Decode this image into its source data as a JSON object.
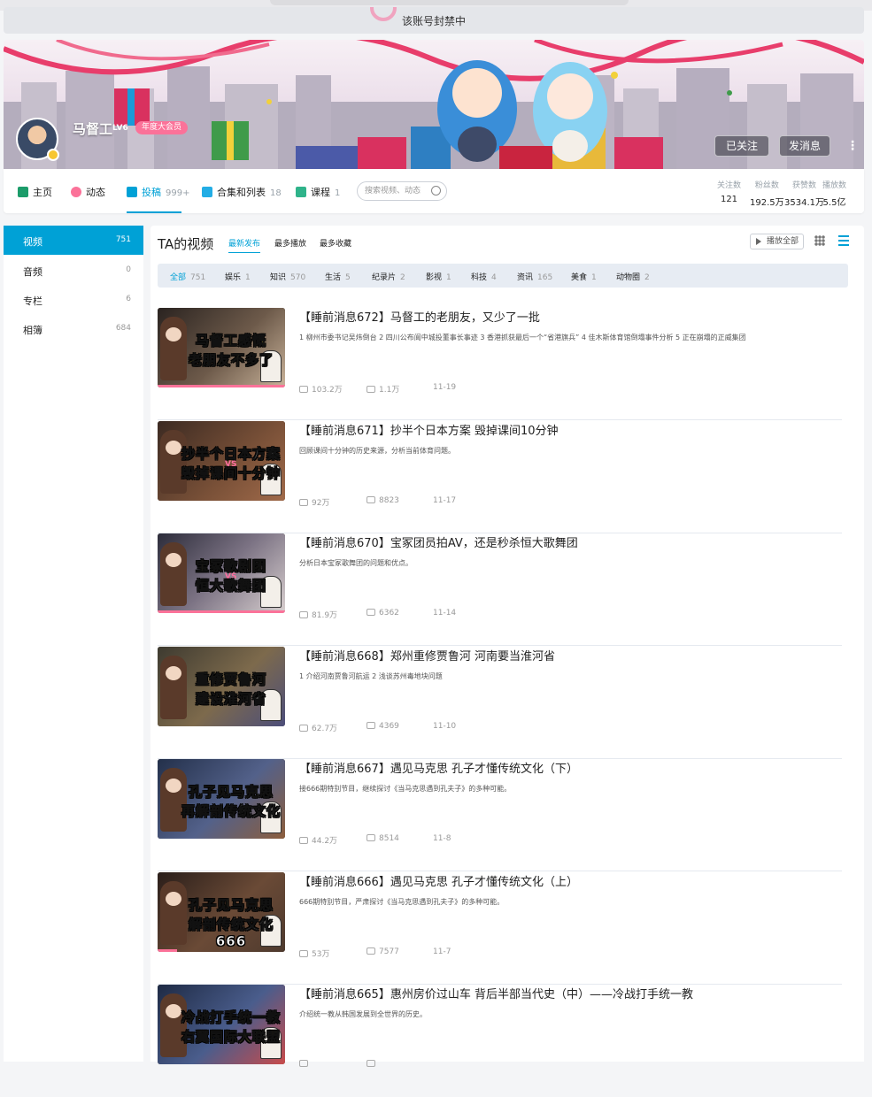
{
  "notice": {
    "text": "该账号封禁中"
  },
  "header": {
    "username": "马督工",
    "level": "LV6",
    "vip_label": "年度大会员",
    "follow_button": "已关注",
    "message_button": "发消息"
  },
  "nav": {
    "tabs": [
      {
        "label": "主页",
        "count": ""
      },
      {
        "label": "动态",
        "count": ""
      },
      {
        "label": "投稿",
        "count": "999+"
      },
      {
        "label": "合集和列表",
        "count": "18"
      },
      {
        "label": "课程",
        "count": "1"
      }
    ],
    "search_placeholder": "搜索视频、动态",
    "stats": [
      {
        "label": "关注数",
        "value": "121"
      },
      {
        "label": "粉丝数",
        "value": "192.5万"
      },
      {
        "label": "获赞数",
        "value": "3534.1万"
      },
      {
        "label": "播放数",
        "value": "5.5亿"
      }
    ]
  },
  "sidebar": {
    "items": [
      {
        "label": "视频",
        "count": "751"
      },
      {
        "label": "音频",
        "count": "0"
      },
      {
        "label": "专栏",
        "count": "6"
      },
      {
        "label": "相簿",
        "count": "684"
      }
    ]
  },
  "main": {
    "title": "TA的视频",
    "sort_tabs": [
      "最新发布",
      "最多播放",
      "最多收藏"
    ],
    "play_all": "播放全部",
    "filters": [
      {
        "label": "全部",
        "count": "751"
      },
      {
        "label": "娱乐",
        "count": "1"
      },
      {
        "label": "知识",
        "count": "570"
      },
      {
        "label": "生活",
        "count": "5"
      },
      {
        "label": "纪录片",
        "count": "2"
      },
      {
        "label": "影视",
        "count": "1"
      },
      {
        "label": "科技",
        "count": "4"
      },
      {
        "label": "资讯",
        "count": "165"
      },
      {
        "label": "美食",
        "count": "1"
      },
      {
        "label": "动物圈",
        "count": "2"
      }
    ],
    "videos": [
      {
        "title": "【睡前消息672】马督工的老朋友，又少了一批",
        "desc": "1 柳州市委书记吴炜倒台 2 四川公布阆中城投董事长事迹 3 香港抓获最后一个“省港旗兵” 4 佳木斯体育馆倒塌事件分析 5 正在崩塌的正威集团",
        "views": "103.2万",
        "comments": "1.1万",
        "date": "11-19",
        "thumb_line1": "马督工感慨",
        "thumb_line2": "老朋友不多了",
        "thumb_vs": ""
      },
      {
        "title": "【睡前消息671】抄半个日本方案 毁掉课间10分钟",
        "desc": "回顾课间十分钟的历史来源，分析当前体育问题。",
        "views": "92万",
        "comments": "8823",
        "date": "11-17",
        "thumb_line1": "抄半个日本方案",
        "thumb_line2": "毁掉课间十分钟",
        "thumb_vs": "VS"
      },
      {
        "title": "【睡前消息670】宝冢团员拍AV，还是秒杀恒大歌舞团",
        "desc": "分析日本宝冢歌舞团的问题和优点。",
        "views": "81.9万",
        "comments": "6362",
        "date": "11-14",
        "thumb_line1": "宝冢歌剧团",
        "thumb_line2": "恒大歌舞团",
        "thumb_vs": "VS"
      },
      {
        "title": "【睡前消息668】郑州重修贾鲁河 河南要当淮河省",
        "desc": "1 介绍河南贾鲁河航运 2 浅谈苏州毒地块问题",
        "views": "62.7万",
        "comments": "4369",
        "date": "11-10",
        "thumb_line1": "重修贾鲁河",
        "thumb_line2": "建设淮河省",
        "thumb_vs": ""
      },
      {
        "title": "【睡前消息667】遇见马克思 孔子才懂传统文化（下）",
        "desc": "接666期特别节目，继续探讨《当马克思遇到孔夫子》的多种可能。",
        "views": "44.2万",
        "comments": "8514",
        "date": "11-8",
        "thumb_line1": "孔子见马克思",
        "thumb_line2": "再解剖传统文化",
        "thumb_vs": ""
      },
      {
        "title": "【睡前消息666】遇见马克思 孔子才懂传统文化（上）",
        "desc": "666期特别节目，严肃探讨《当马克思遇到孔夫子》的多种可能。",
        "views": "53万",
        "comments": "7577",
        "date": "11-7",
        "thumb_line1": "孔子见马克思",
        "thumb_line2": "解剖传统文化666",
        "thumb_vs": ""
      },
      {
        "title": "【睡前消息665】惠州房价过山车 背后半部当代史（中）——冷战打手统一教",
        "desc": "介绍统一教从韩国发展到全世界的历史。",
        "views": "",
        "comments": "",
        "date": "",
        "thumb_line1": "冷战打手统一教",
        "thumb_line2": "右翼国际大联盟",
        "thumb_vs": ""
      }
    ]
  },
  "colors": {
    "accent": "#00a1d6",
    "pink": "#fb7299"
  },
  "progress": [
    1.0,
    0.0,
    1.0,
    0.0,
    0.0,
    0.15,
    0.0
  ]
}
